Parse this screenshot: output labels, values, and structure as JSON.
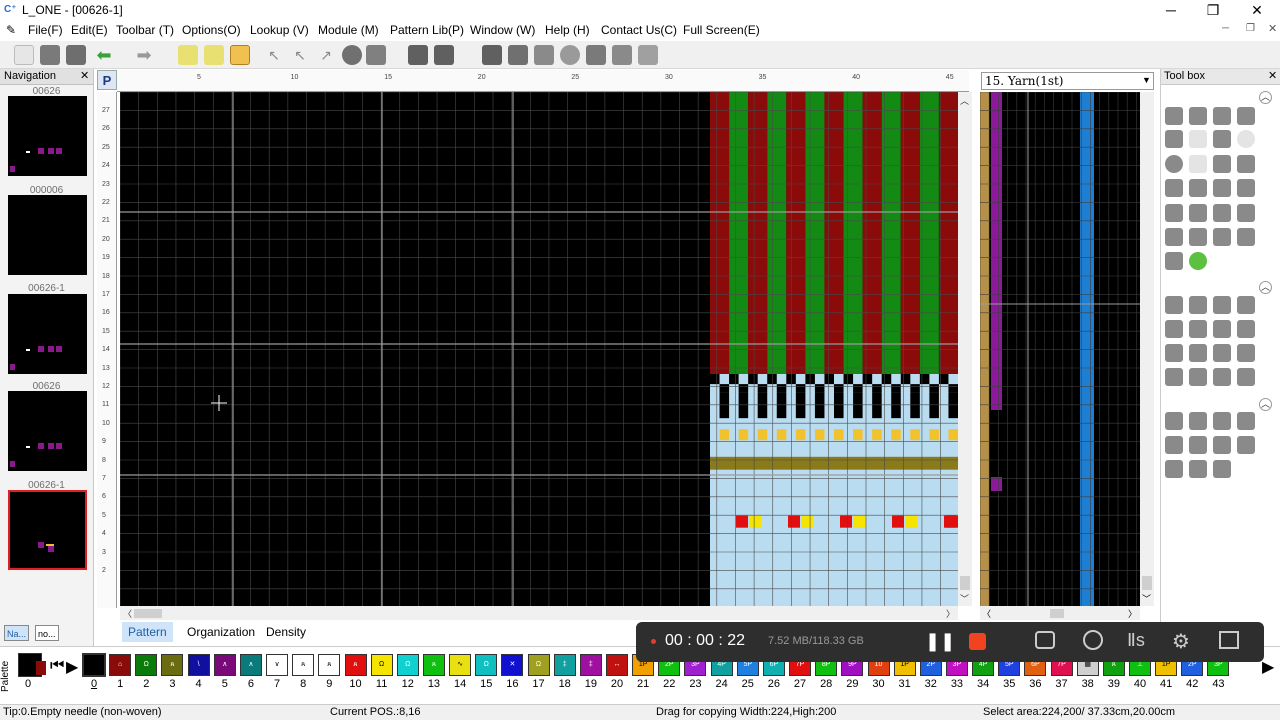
{
  "window": {
    "title": "L_ONE - [00626-1]",
    "buttons": [
      "─",
      "❐",
      "✕"
    ]
  },
  "menu": [
    "File(F)",
    "Edit(E)",
    "Toolbar (T)",
    "Options(O)",
    "Lookup (V)",
    "Module (M)",
    "Pattern Lib(P)",
    "Window (W)",
    "Help (H)",
    "Contact Us(C)",
    "Full Screen(E)"
  ],
  "navigation": {
    "title": "Navigation",
    "items": [
      {
        "label": "00626",
        "selected": false
      },
      {
        "label": "000006",
        "selected": false
      },
      {
        "label": "00626-1",
        "selected": false
      },
      {
        "label": "00626",
        "selected": false
      },
      {
        "label": "00626-1",
        "selected": true
      }
    ],
    "tabs": [
      "Na...",
      "no..."
    ]
  },
  "editor": {
    "ruler_corner": "P",
    "top_ruler_labels": [
      "5",
      "10",
      "15",
      "20",
      "25",
      "30",
      "35",
      "40",
      "45"
    ],
    "left_ruler_labels": [
      "27",
      "26",
      "25",
      "24",
      "23",
      "22",
      "21",
      "20",
      "19",
      "18",
      "17",
      "16",
      "15",
      "14",
      "13",
      "12",
      "11",
      "10",
      "9",
      "8",
      "7",
      "6",
      "5",
      "4",
      "3",
      "2"
    ],
    "colors": {
      "background": "#000000",
      "red": "#8b0a0a",
      "green": "#138a13",
      "light": "#cfe8c8",
      "lightblue": "#b9dcf0",
      "yellow": "#f2c12e",
      "olive": "#8a7a1a",
      "brightred": "#e01010",
      "brightyellow": "#f5e400"
    }
  },
  "yarn": {
    "selected": "15. Yarn(1st)",
    "colors": {
      "tan": "#b59048",
      "purple": "#8a1a9a",
      "blue": "#1e7fd2",
      "bar": "#5a3a10"
    }
  },
  "toolbox": {
    "title": "Tool box"
  },
  "tabs": [
    {
      "label": "Pattern",
      "active": true
    },
    {
      "label": "Organization",
      "active": false
    },
    {
      "label": "Density",
      "active": false
    }
  ],
  "recorder": {
    "time": "00 : 00 : 22",
    "storage": "7.52 MB/118.33 GB"
  },
  "palette": {
    "label": "Palette",
    "selected_index": "0",
    "items": [
      {
        "num": "0",
        "color": "#000000",
        "sym": ""
      },
      {
        "num": "1",
        "color": "#8b0a0a",
        "sym": "⌂"
      },
      {
        "num": "2",
        "color": "#0a7a0a",
        "sym": "Ω"
      },
      {
        "num": "3",
        "color": "#6b6b10",
        "sym": "ጰ"
      },
      {
        "num": "4",
        "color": "#1010a0",
        "sym": "\\"
      },
      {
        "num": "5",
        "color": "#7a0a7a",
        "sym": "∧"
      },
      {
        "num": "6",
        "color": "#0a7a7a",
        "sym": "∧"
      },
      {
        "num": "7",
        "color": "#ffffff",
        "sym": "∨"
      },
      {
        "num": "8",
        "color": "#ffffff",
        "sym": "ጰ"
      },
      {
        "num": "9",
        "color": "#ffffff",
        "sym": "ጰ"
      },
      {
        "num": "10",
        "color": "#e01010",
        "sym": "ጰ"
      },
      {
        "num": "11",
        "color": "#f5e400",
        "sym": "Ω"
      },
      {
        "num": "12",
        "color": "#10d0d0",
        "sym": "Ω"
      },
      {
        "num": "13",
        "color": "#10c010",
        "sym": "ጰ"
      },
      {
        "num": "14",
        "color": "#e8e010",
        "sym": "∿"
      },
      {
        "num": "15",
        "color": "#10c0c0",
        "sym": "Ω"
      },
      {
        "num": "16",
        "color": "#1010d0",
        "sym": "✕"
      },
      {
        "num": "17",
        "color": "#a0a020",
        "sym": "Ω"
      },
      {
        "num": "18",
        "color": "#10a0a0",
        "sym": "‡"
      },
      {
        "num": "19",
        "color": "#a010a0",
        "sym": "‡"
      },
      {
        "num": "20",
        "color": "#c01010",
        "sym": "↔"
      },
      {
        "num": "21",
        "color": "#f2a000",
        "sym": "1P"
      },
      {
        "num": "22",
        "color": "#10c010",
        "sym": "2P"
      },
      {
        "num": "23",
        "color": "#a020d0",
        "sym": "3P"
      },
      {
        "num": "24",
        "color": "#10a0a0",
        "sym": "4P"
      },
      {
        "num": "25",
        "color": "#2080e0",
        "sym": "5P"
      },
      {
        "num": "26",
        "color": "#10b0b0",
        "sym": "6P"
      },
      {
        "num": "27",
        "color": "#e01010",
        "sym": "7P"
      },
      {
        "num": "28",
        "color": "#10c010",
        "sym": "8P"
      },
      {
        "num": "29",
        "color": "#a010c0",
        "sym": "9P"
      },
      {
        "num": "30",
        "color": "#e04010",
        "sym": "10"
      },
      {
        "num": "31",
        "color": "#f0c000",
        "sym": "1P"
      },
      {
        "num": "32",
        "color": "#2060e0",
        "sym": "2P"
      },
      {
        "num": "33",
        "color": "#c010c0",
        "sym": "3P"
      },
      {
        "num": "34",
        "color": "#10a010",
        "sym": "4P"
      },
      {
        "num": "35",
        "color": "#2040e0",
        "sym": "5P"
      },
      {
        "num": "36",
        "color": "#e06010",
        "sym": "6P"
      },
      {
        "num": "37",
        "color": "#e01050",
        "sym": "7P"
      },
      {
        "num": "38",
        "color": "#d0d0d0",
        "sym": "▦"
      },
      {
        "num": "39",
        "color": "#10a010",
        "sym": "ጰ"
      },
      {
        "num": "40",
        "color": "#10c010",
        "sym": "⊥"
      },
      {
        "num": "41",
        "color": "#f0c000",
        "sym": "1P"
      },
      {
        "num": "42",
        "color": "#2060e0",
        "sym": "2P"
      },
      {
        "num": "43",
        "color": "#10c010",
        "sym": "3P"
      }
    ]
  },
  "status": {
    "tip": "Tip:0.Empty needle (non-woven)",
    "pos": "Current POS.:8,16",
    "drag": "Drag for copying Width:224,High:200",
    "area": "Select area:224,200/ 37.33cm,20.00cm"
  }
}
